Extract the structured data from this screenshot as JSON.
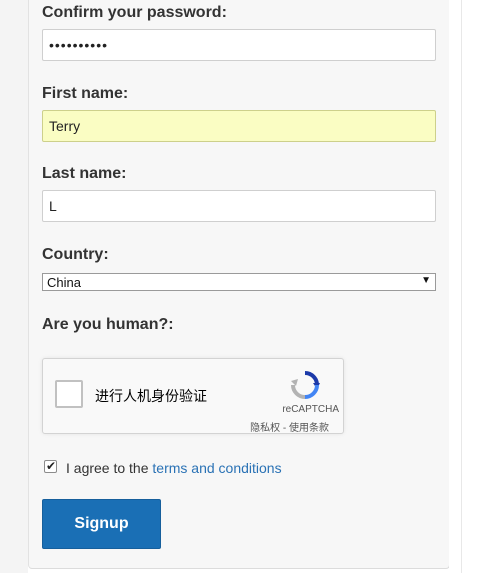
{
  "form": {
    "confirm_password": {
      "label": "Confirm your password:",
      "value": "••••••••••"
    },
    "first_name": {
      "label": "First name:",
      "value": "Terry"
    },
    "last_name": {
      "label": "Last name:",
      "value": "L"
    },
    "country": {
      "label": "Country:",
      "selected": "China"
    },
    "captcha": {
      "label": "Are you human?:",
      "checkbox_text": "进行人机身份验证",
      "brand": "reCAPTCHA",
      "links": "隐私权 - 使用条款"
    },
    "agree": {
      "checked": true,
      "prefix": "I agree to the ",
      "link_text": "terms and conditions"
    },
    "submit_label": "Signup"
  },
  "colors": {
    "autofill_bg": "#fafdc3",
    "button_bg": "#1a6fb5",
    "link": "#2a72b5"
  }
}
